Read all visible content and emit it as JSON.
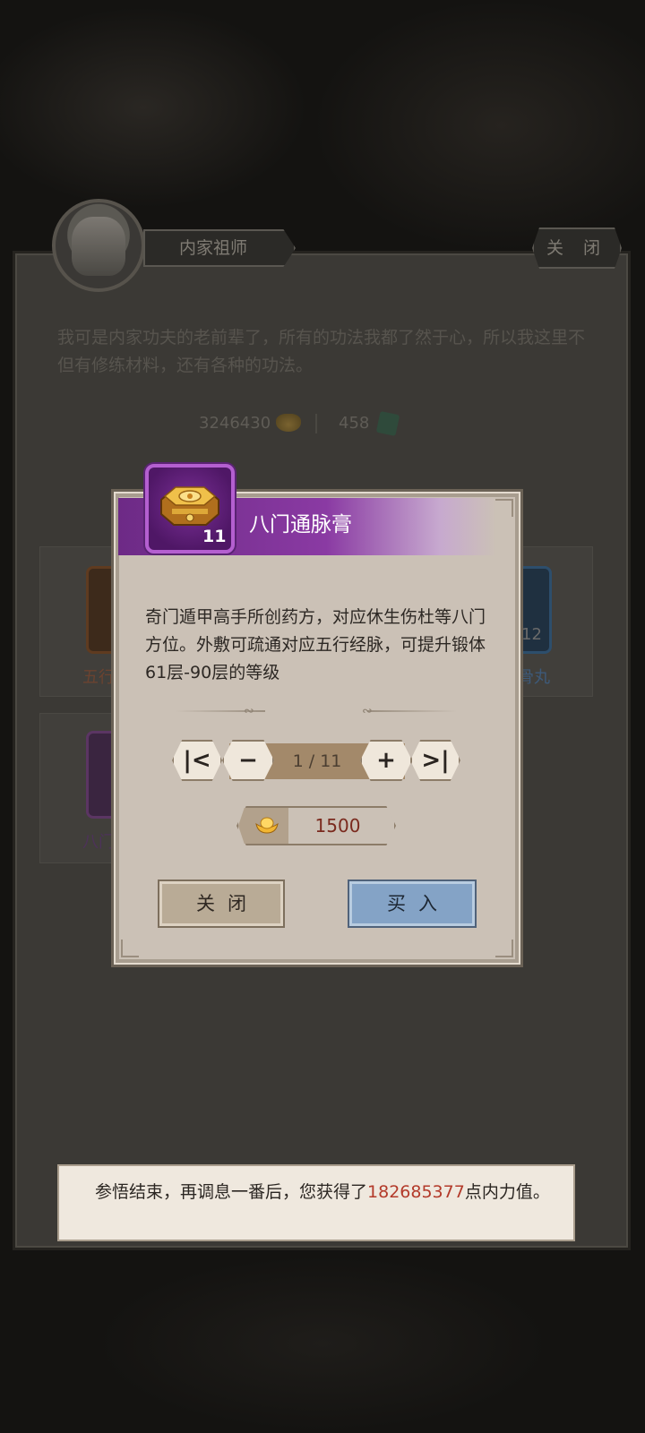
{
  "npc": {
    "name": "内家祖师",
    "close_label": "关 闭",
    "intro": "我可是内家功夫的老前辈了，所有的功法我都了然于心，所以我这里不但有修练材料，还有各种的功法。"
  },
  "currency": {
    "gold": "3246430",
    "jade": "458"
  },
  "background_items": {
    "left_label": "五行",
    "right_label": "骨丸",
    "right_count": "12",
    "bottom_left_label": "八门"
  },
  "modal": {
    "item_name": "八门通脉膏",
    "item_count": "11",
    "description": "奇门遁甲高手所创药方，对应休生伤杜等八门方位。外敷可疏通对应五行经脉，可提升锻体61层-90层的等级",
    "stepper_value": "1 / 11",
    "stepper_first": "|<",
    "stepper_minus": "−",
    "stepper_plus": "+",
    "stepper_last": ">|",
    "price": "1500",
    "close_label": "关闭",
    "buy_label": "买入"
  },
  "toast": {
    "prefix": "参悟结束，再调息一番后，您获得了",
    "amount": "182685377",
    "suffix": "点内力值。"
  },
  "colors": {
    "title_purple": "#8a3aa3",
    "price_red": "#7a2a1e",
    "toast_number_red": "#b33a2a",
    "buy_blue": "#84a3c6"
  },
  "icons": {
    "item": "octagonal-gold-box-icon",
    "price": "gold-ingot-icon",
    "jade": "jade-token-icon"
  }
}
